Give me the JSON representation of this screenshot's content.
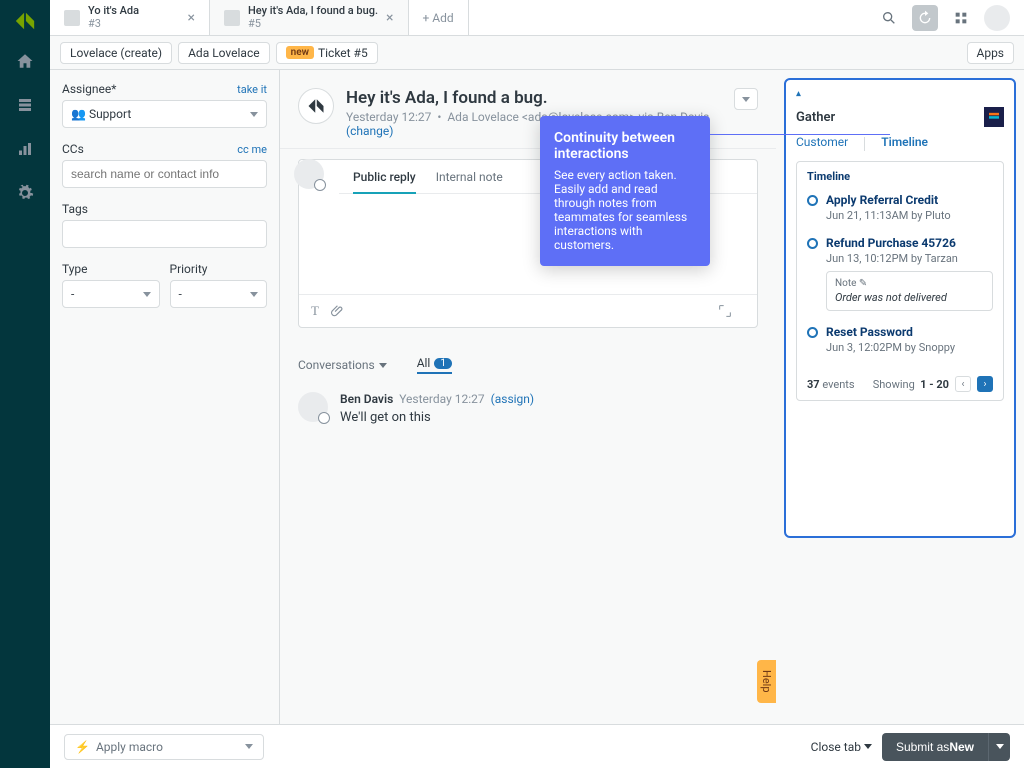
{
  "tabs": [
    {
      "title": "Yo it's Ada",
      "sub": "#3"
    },
    {
      "title": "Hey it's Ada, I found a bug.",
      "sub": "#5"
    }
  ],
  "add_tab_label": "+ Add",
  "breadcrumbs": {
    "org": "Lovelace (create)",
    "user": "Ada Lovelace",
    "status_label": "new",
    "ticket_label": "Ticket #5",
    "apps_label": "Apps"
  },
  "sidebar": {
    "assignee_label": "Assignee*",
    "take_it": "take it",
    "assignee_value": "Support",
    "ccs_label": "CCs",
    "cc_me": "cc me",
    "ccs_placeholder": "search name or contact info",
    "tags_label": "Tags",
    "type_label": "Type",
    "type_value": "-",
    "priority_label": "Priority",
    "priority_value": "-"
  },
  "ticket": {
    "title": "Hey it's Ada, I found a bug.",
    "timestamp": "Yesterday 12:27",
    "requester": "Ada Lovelace <ada@lovelace.com> via Ben Davis",
    "change": "(change)"
  },
  "compose": {
    "tab_public": "Public reply",
    "tab_internal": "Internal note"
  },
  "convo": {
    "conversations_label": "Conversations",
    "all_label": "All",
    "all_count": "1"
  },
  "message": {
    "author": "Ben Davis",
    "time": "Yesterday 12:27",
    "assign": "(assign)",
    "body": "We'll get on this"
  },
  "callout": {
    "title": "Continuity between interactions",
    "body": "See every action taken. Easily add and read through notes from teammates for seamless interactions with customers."
  },
  "gather": {
    "title": "Gather",
    "tab_customer": "Customer",
    "tab_timeline": "Timeline",
    "section_title": "Timeline",
    "events": [
      {
        "title": "Apply Referral Credit",
        "meta": "Jun 21, 11:13AM by Pluto"
      },
      {
        "title": "Refund Purchase 45726",
        "meta": "Jun 13, 10:12PM by Tarzan",
        "note_label": "Note",
        "note_text": "Order was not delivered"
      },
      {
        "title": "Reset Password",
        "meta": "Jun 3, 12:02PM by Snoppy"
      }
    ],
    "events_count": "37",
    "events_word": "events",
    "showing": "Showing",
    "range": "1 - 20"
  },
  "footer": {
    "macro_label": "Apply macro",
    "close_tab": "Close tab",
    "submit_prefix": "Submit as ",
    "submit_status": "New"
  },
  "help_label": "Help",
  "icons": {
    "assignee_prefix": "👥"
  }
}
